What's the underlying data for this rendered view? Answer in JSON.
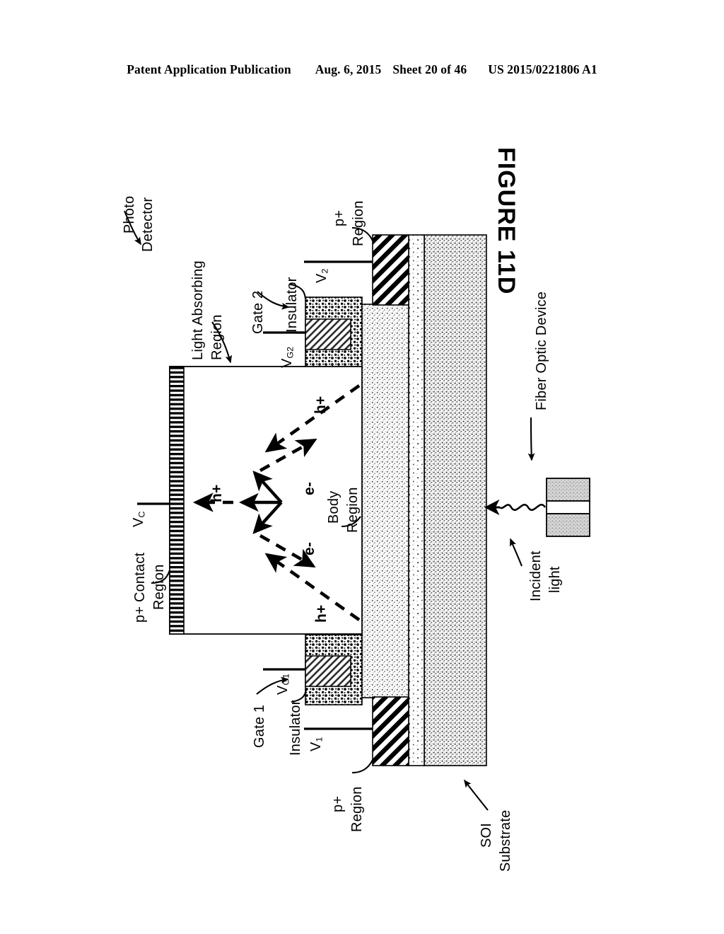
{
  "header": {
    "publication": "Patent Application Publication",
    "date": "Aug. 6, 2015",
    "sheet": "Sheet 20 of 46",
    "patent_number": "US 2015/0221806 A1"
  },
  "figure": {
    "title": "FIGURE 11D"
  },
  "labels": {
    "photo_detector_line1": "Photo",
    "photo_detector_line2": "Detector",
    "light_absorbing_line1": "Light Absorbing",
    "light_absorbing_line2": "Region",
    "gate2": "Gate 2",
    "insulator_top": "Insulator",
    "p_plus_region_top_line1": "p+",
    "p_plus_region_top_line2": "Region",
    "p_contact_line1": "p+ Contact",
    "p_contact_line2": "Region",
    "body_region_line1": "Body",
    "body_region_line2": "Region",
    "gate1": "Gate 1",
    "insulator_bottom": "Insulator",
    "p_plus_region_bottom_line1": "p+",
    "p_plus_region_bottom_line2": "Region",
    "soi_substrate_line1": "SOI",
    "soi_substrate_line2": "Substrate",
    "fiber_optic_device": "Fiber Optic Device",
    "incident_light_line1": "Incident",
    "incident_light_line2": "light"
  },
  "terminals": {
    "v_c": "V",
    "v_c_sub": "C",
    "v_g2": "V",
    "v_g2_sub": "G2",
    "v_2": "V",
    "v_2_sub": "2",
    "v_g1": "V",
    "v_g1_sub": "G1",
    "v_1": "V",
    "v_1_sub": "1"
  },
  "carriers": {
    "hole_top": "h+",
    "hole_mid": "h+",
    "hole_bottom": "h+",
    "electron_upper": "e-",
    "electron_lower": "e-"
  },
  "colors": {
    "ink": "#000000",
    "paper": "#ffffff",
    "substrate_fill": "#c9c9c9",
    "body_fill": "#d8d8d8",
    "box_fill": "#efefef",
    "fiber_fill": "#bdbdbd"
  }
}
